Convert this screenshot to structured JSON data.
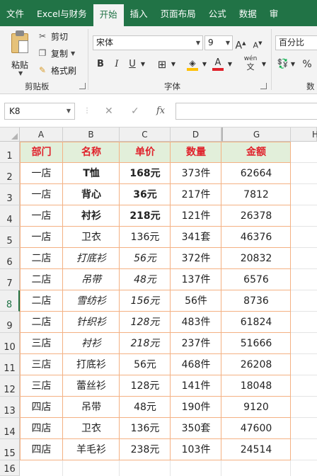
{
  "ribbon_tabs": [
    "文件",
    "Excel与财务",
    "开始",
    "插入",
    "页面布局",
    "公式",
    "数据",
    "审"
  ],
  "active_tab_index": 2,
  "clipboard": {
    "paste_label": "粘贴",
    "cut_label": "剪切",
    "copy_label": "复制",
    "format_painter_label": "格式刷",
    "group_label": "剪贴板"
  },
  "font": {
    "name": "宋体",
    "size": "9",
    "increase_label": "A",
    "decrease_label": "A",
    "bold_label": "B",
    "italic_label": "I",
    "underline_label": "U",
    "phonetic_label": "wén",
    "group_label": "字体"
  },
  "number": {
    "format": "百分比",
    "percent_label": "%",
    "group_label": "数"
  },
  "formula_bar": {
    "name_box": "K8",
    "cancel_icon": "✕",
    "enter_icon": "✓",
    "fx_label": "fx",
    "formula": ""
  },
  "columns": [
    "A",
    "B",
    "C",
    "D",
    "G",
    "H"
  ],
  "row_numbers": [
    "1",
    "2",
    "3",
    "4",
    "5",
    "6",
    "7",
    "8",
    "9",
    "10",
    "11",
    "12",
    "13",
    "14",
    "15",
    "16"
  ],
  "selected_row": "8",
  "table": {
    "headers": [
      "部门",
      "名称",
      "单价",
      "数量",
      "金额"
    ],
    "rows": [
      [
        "一店",
        "T恤",
        "168元",
        "373件",
        "62664"
      ],
      [
        "一店",
        "背心",
        "36元",
        "217件",
        "7812"
      ],
      [
        "一店",
        "衬衫",
        "218元",
        "121件",
        "26378"
      ],
      [
        "一店",
        "卫衣",
        "136元",
        "341套",
        "46376"
      ],
      [
        "二店",
        "打底衫",
        "56元",
        "372件",
        "20832"
      ],
      [
        "二店",
        "吊带",
        "48元",
        "137件",
        "6576"
      ],
      [
        "二店",
        "雪纺衫",
        "156元",
        "56件",
        "8736"
      ],
      [
        "二店",
        "针织衫",
        "128元",
        "483件",
        "61824"
      ],
      [
        "三店",
        "衬衫",
        "218元",
        "237件",
        "51666"
      ],
      [
        "三店",
        "打底衫",
        "56元",
        "468件",
        "26208"
      ],
      [
        "三店",
        "蕾丝衫",
        "128元",
        "141件",
        "18048"
      ],
      [
        "四店",
        "吊带",
        "48元",
        "190件",
        "9120"
      ],
      [
        "四店",
        "卫衣",
        "136元",
        "350套",
        "47600"
      ],
      [
        "四店",
        "羊毛衫",
        "238元",
        "103件",
        "24514"
      ]
    ]
  },
  "colors": {
    "ribbon": "#217346",
    "header_fill": "#e2efda",
    "header_text": "#e0202a",
    "table_border": "#f4b183"
  }
}
